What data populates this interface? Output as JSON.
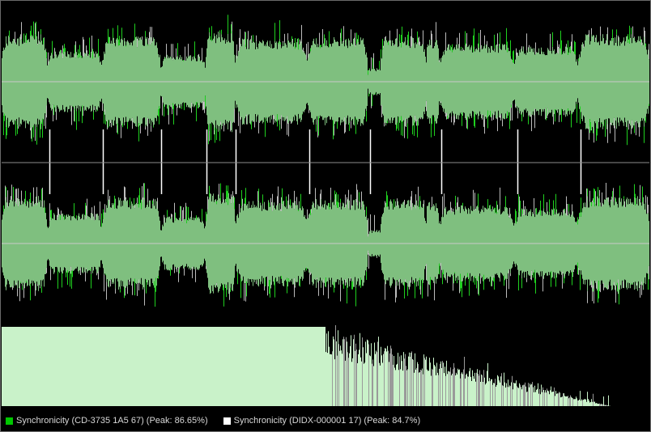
{
  "colors": {
    "background": "#000000",
    "waveform_fill": "#7fbf7f",
    "waveform_peak_a": "#1fd11f",
    "waveform_peak_b": "#bcbcbc",
    "center_line": "#c8c8c8",
    "divider": "#8c8c8c",
    "marker": "#ffffff",
    "spectrum_fill": "#c9f2c9",
    "spectrum_overlay": "#9a9a9a"
  },
  "legend": {
    "track_a": {
      "label": "Synchronicity (CD-3735 1A5 67) (Peak: 86.65%)",
      "color": "#00c800"
    },
    "track_b": {
      "label": "Synchronicity (DIDX-000001 17) (Peak: 84.7%)",
      "color": "#ffffff"
    }
  },
  "waveform": {
    "segments": [
      {
        "start": 0.0,
        "end": 0.07,
        "level": 0.62
      },
      {
        "start": 0.07,
        "end": 0.155,
        "level": 0.4
      },
      {
        "start": 0.155,
        "end": 0.245,
        "level": 0.6
      },
      {
        "start": 0.245,
        "end": 0.315,
        "level": 0.35
      },
      {
        "start": 0.315,
        "end": 0.36,
        "level": 0.66
      },
      {
        "start": 0.36,
        "end": 0.472,
        "level": 0.56
      },
      {
        "start": 0.472,
        "end": 0.565,
        "level": 0.58
      },
      {
        "start": 0.565,
        "end": 0.585,
        "level": 0.18
      },
      {
        "start": 0.585,
        "end": 0.655,
        "level": 0.58
      },
      {
        "start": 0.655,
        "end": 0.675,
        "level": 0.56
      },
      {
        "start": 0.675,
        "end": 0.79,
        "level": 0.5
      },
      {
        "start": 0.79,
        "end": 0.89,
        "level": 0.46
      },
      {
        "start": 0.89,
        "end": 1.0,
        "level": 0.62
      }
    ],
    "markers": [
      0.075,
      0.157,
      0.248,
      0.317,
      0.362,
      0.476,
      0.57,
      0.68,
      0.797,
      0.895
    ],
    "spectrum": {
      "flat_until": 0.5,
      "end": 0.94,
      "fill_level": 0.98
    }
  }
}
